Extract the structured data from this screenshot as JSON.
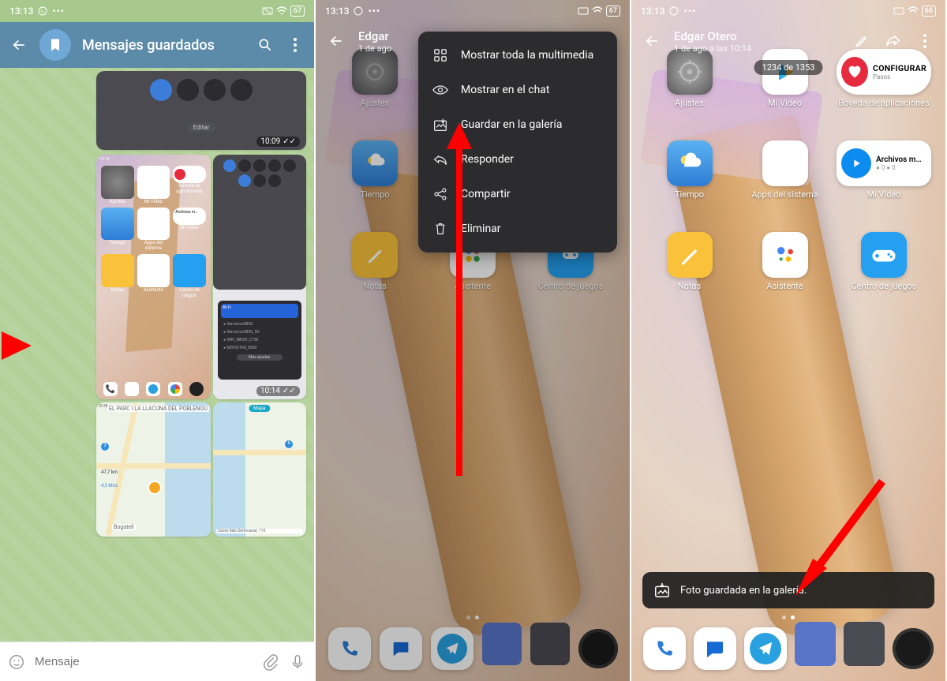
{
  "statusBar": {
    "time": "13:13",
    "batteryA": "67",
    "batteryC": "66"
  },
  "screen1": {
    "title": "Mensajes guardados",
    "inputPlaceholder": "Mensaje",
    "msg1": {
      "time": "10:09",
      "editLabel": "Editar"
    },
    "msg2": {
      "time": "10:14"
    },
    "thumb": {
      "configure": "CONFIGURAR",
      "steps": "Pasos",
      "apps": [
        "Ajustes",
        "Mi Vídeo",
        "Bóveda de aplicaciones",
        "Tiempo",
        "Apps del sistema",
        "Mi Vídeo",
        "Notas",
        "Asistente",
        "Centro de juegos"
      ],
      "archivos": "Archivos m…"
    },
    "map": {
      "label1": "EL PARC I LA LLACUNA DEL POBLENOU",
      "label2": "Bogatell",
      "label3": "Carrer dels Sertimanat, 115",
      "mapa": "Mapa",
      "dist": "47,7 km",
      "price": "4,3 Mcs"
    }
  },
  "screen2": {
    "name": "Edgar",
    "date": "1 de ago",
    "menu": [
      "Mostrar toda la multimedia",
      "Mostrar en el chat",
      "Guardar en la galería",
      "Responder",
      "Compartir",
      "Eliminar"
    ],
    "apps": {
      "row1": [
        "Ajustes",
        "",
        ""
      ],
      "row2": [
        "Tiempo",
        "",
        ""
      ],
      "row3": [
        "Notas",
        "Asistente",
        "Centro de juegos"
      ]
    }
  },
  "screen3": {
    "name": "Edgar Otero",
    "date": "1 de ago a las 10:14",
    "counter": "1234 de 1353",
    "configure": "CONFIGURAR",
    "steps": "Pasos",
    "archivos": "Archivos m…",
    "apps": [
      "Ajustes",
      "Mi Vídeo",
      "Bóveda de aplicaciones",
      "Tiempo",
      "Apps del sistema",
      "Mi Vídeo",
      "Notas",
      "Asistente",
      "Centro de juegos"
    ],
    "toast": "Foto guardada en la galería."
  },
  "sub0": "● 0  ● 0"
}
